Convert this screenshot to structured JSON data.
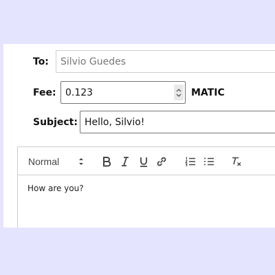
{
  "to": {
    "label": "To:",
    "placeholder": "Silvio Guedes"
  },
  "fee": {
    "label": "Fee:",
    "value": "0.123",
    "unit": "MATIC"
  },
  "subject": {
    "label": "Subject:",
    "value": "Hello, Silvio!"
  },
  "editor": {
    "font_select": "Normal",
    "toolbar_icons": [
      "chevron-updown-icon",
      "bold-icon",
      "italic-icon",
      "underline-icon",
      "link-icon",
      "ordered-list-icon",
      "bullet-list-icon",
      "clear-format-icon"
    ],
    "body_text": "How are you?"
  },
  "colors": {
    "page_background": "#e4e4ff",
    "panel_background": "#ffffff",
    "border": "#cccccc",
    "icon": "#444444"
  }
}
